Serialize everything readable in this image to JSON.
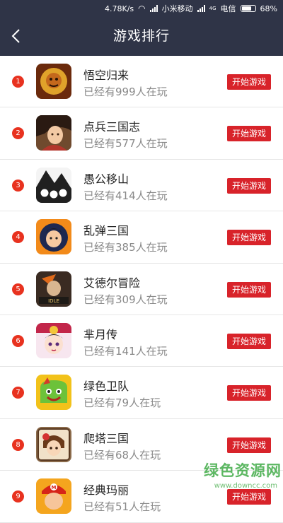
{
  "status_bar": {
    "speed": "4.78K/s",
    "carrier1": "小米移动",
    "network_tag": "4G",
    "carrier2": "电信",
    "battery": "68%"
  },
  "header": {
    "title": "游戏排行"
  },
  "games": [
    {
      "rank": "1",
      "name": "悟空归来",
      "players": "已经有999人在玩",
      "button": "开始游戏"
    },
    {
      "rank": "2",
      "name": "点兵三国志",
      "players": "已经有577人在玩",
      "button": "开始游戏"
    },
    {
      "rank": "3",
      "name": "愚公移山",
      "players": "已经有414人在玩",
      "button": "开始游戏"
    },
    {
      "rank": "4",
      "name": "乱弹三国",
      "players": "已经有385人在玩",
      "button": "开始游戏"
    },
    {
      "rank": "5",
      "name": "艾德尔冒险",
      "players": "已经有309人在玩",
      "button": "开始游戏"
    },
    {
      "rank": "6",
      "name": "芈月传",
      "players": "已经有141人在玩",
      "button": "开始游戏"
    },
    {
      "rank": "7",
      "name": "绿色卫队",
      "players": "已经有79人在玩",
      "button": "开始游戏"
    },
    {
      "rank": "8",
      "name": "爬塔三国",
      "players": "已经有68人在玩",
      "button": "开始游戏"
    },
    {
      "rank": "9",
      "name": "经典玛丽",
      "players": "已经有51人在玩",
      "button": "开始游戏"
    }
  ],
  "watermark": {
    "main": "绿色资源网",
    "sub": "www.downcc.com"
  },
  "colors": {
    "header_bg": "#2f3447",
    "accent_red": "#d8232a",
    "rank_red": "#e8321f"
  }
}
